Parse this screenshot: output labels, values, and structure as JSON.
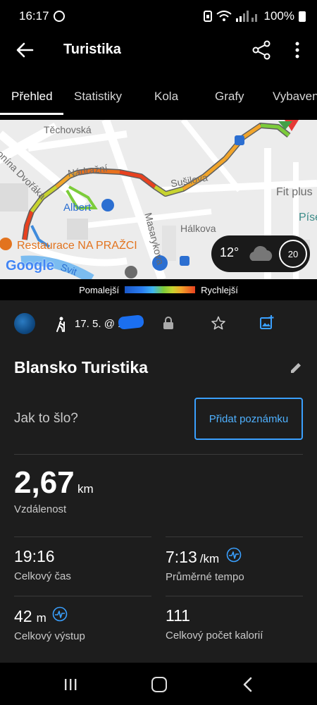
{
  "status_bar": {
    "time": "16:17",
    "volte": "Vo))\nLTE1",
    "battery": "100%"
  },
  "app_bar": {
    "title": "Turistika"
  },
  "tabs": [
    {
      "label": "Přehled",
      "active": true
    },
    {
      "label": "Statistiky",
      "active": false
    },
    {
      "label": "Kola",
      "active": false
    },
    {
      "label": "Grafy",
      "active": false
    },
    {
      "label": "Vybaven",
      "active": false
    }
  ],
  "map": {
    "labels": {
      "street1": "Těchovská",
      "street2": "onína Dvořáka",
      "street3": "Nádražní",
      "street4": "Sušilova",
      "street5": "Fit plus",
      "street6": "Písečná",
      "street7": "Hálkova",
      "street8": "Masarykova",
      "poi1": "Albert",
      "poi2": "Restaurace NA PRAŽCI",
      "river": "Svit",
      "google": "Google"
    },
    "weather": {
      "temperature": "12°",
      "wind": "20"
    }
  },
  "legend": {
    "slower": "Pomalejší",
    "faster": "Rychlejší"
  },
  "activity": {
    "date": "17. 5. @ 1",
    "title": "Blansko Turistika",
    "how_it_went": "Jak to šlo?",
    "add_note": "Přidat poznámku",
    "distance": {
      "value": "2,67",
      "unit": "km",
      "label": "Vzdálenost"
    },
    "stats": [
      {
        "value": "19:16",
        "unit": "",
        "label": "Celkový čas"
      },
      {
        "value": "7:13",
        "unit": "/km",
        "label": "Průměrné tempo"
      },
      {
        "value": "42",
        "unit": "m",
        "label": "Celkový výstup"
      },
      {
        "value": "111",
        "unit": "",
        "label": "Celkový počet kalorií"
      }
    ]
  },
  "colors": {
    "accent": "#3aa0ff",
    "background": "#1d1d1d",
    "track_slow": "#1a57c8",
    "track_fast": "#e8411f"
  }
}
